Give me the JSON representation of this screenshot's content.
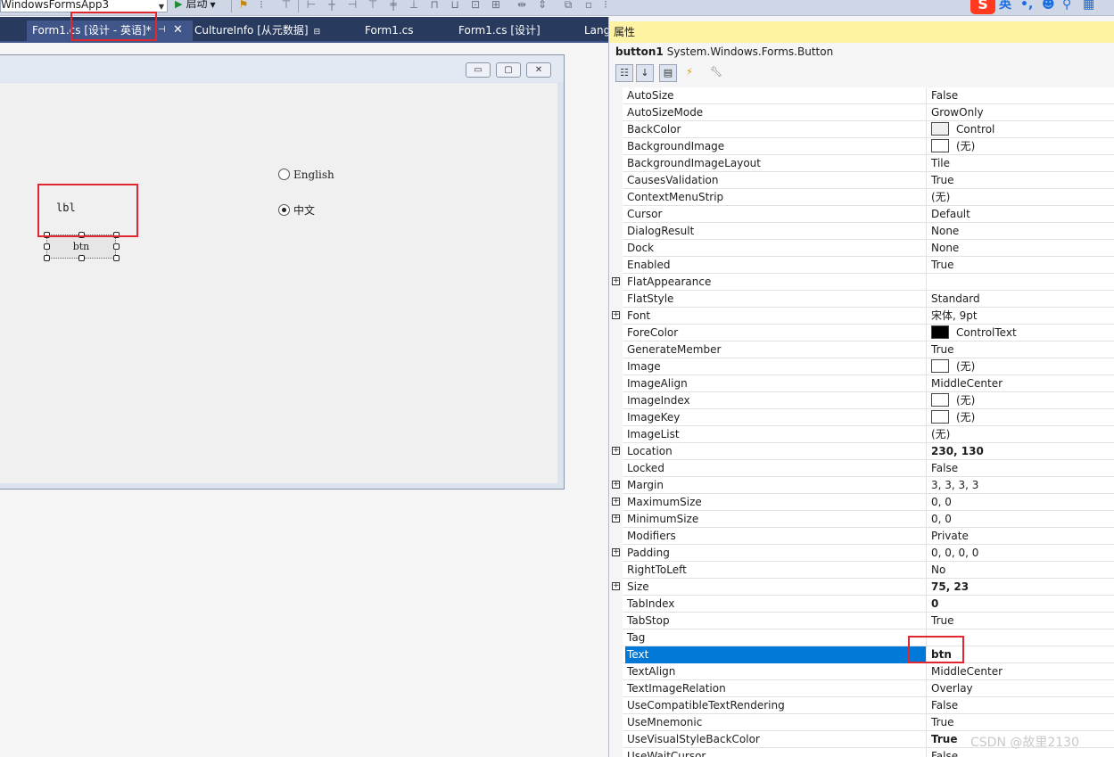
{
  "toolbar": {
    "project_name": "WindowsFormsApp3",
    "start_label": "启动"
  },
  "tabs": [
    {
      "label": "Form1.cs [设计 - 英语]*",
      "active": true
    },
    {
      "label": "CultureInfo [从元数据]"
    },
    {
      "label": "Form1.cs"
    },
    {
      "label": "Form1.cs [设计]"
    },
    {
      "label": "Lang"
    }
  ],
  "ime": {
    "language": "英",
    "punct": "•,"
  },
  "form": {
    "radio_english": "English",
    "radio_chinese": "中文",
    "radio_selected": "中文",
    "label_text": "lbl",
    "button_text": "btn"
  },
  "properties": {
    "title": "属性",
    "object_name": "button1",
    "object_type": "System.Windows.Forms.Button",
    "rows": [
      {
        "name": "AutoSize",
        "value": "False"
      },
      {
        "name": "AutoSizeMode",
        "value": "GrowOnly"
      },
      {
        "name": "BackColor",
        "value": "Control",
        "swatch": "control"
      },
      {
        "name": "BackgroundImage",
        "value": "(无)",
        "swatch": "white"
      },
      {
        "name": "BackgroundImageLayout",
        "value": "Tile"
      },
      {
        "name": "CausesValidation",
        "value": "True"
      },
      {
        "name": "ContextMenuStrip",
        "value": "(无)"
      },
      {
        "name": "Cursor",
        "value": "Default"
      },
      {
        "name": "DialogResult",
        "value": "None"
      },
      {
        "name": "Dock",
        "value": "None"
      },
      {
        "name": "Enabled",
        "value": "True"
      },
      {
        "name": "FlatAppearance",
        "value": "",
        "expandable": true
      },
      {
        "name": "FlatStyle",
        "value": "Standard"
      },
      {
        "name": "Font",
        "value": "宋体, 9pt",
        "expandable": true
      },
      {
        "name": "ForeColor",
        "value": "ControlText",
        "swatch": "black"
      },
      {
        "name": "GenerateMember",
        "value": "True"
      },
      {
        "name": "Image",
        "value": "(无)",
        "swatch": "white"
      },
      {
        "name": "ImageAlign",
        "value": "MiddleCenter"
      },
      {
        "name": "ImageIndex",
        "value": "(无)",
        "swatch": "white"
      },
      {
        "name": "ImageKey",
        "value": "(无)",
        "swatch": "white"
      },
      {
        "name": "ImageList",
        "value": "(无)"
      },
      {
        "name": "Location",
        "value": "230, 130",
        "expandable": true,
        "bold": true
      },
      {
        "name": "Locked",
        "value": "False"
      },
      {
        "name": "Margin",
        "value": "3, 3, 3, 3",
        "expandable": true
      },
      {
        "name": "MaximumSize",
        "value": "0, 0",
        "expandable": true
      },
      {
        "name": "MinimumSize",
        "value": "0, 0",
        "expandable": true
      },
      {
        "name": "Modifiers",
        "value": "Private"
      },
      {
        "name": "Padding",
        "value": "0, 0, 0, 0",
        "expandable": true
      },
      {
        "name": "RightToLeft",
        "value": "No"
      },
      {
        "name": "Size",
        "value": "75, 23",
        "expandable": true,
        "bold": true
      },
      {
        "name": "TabIndex",
        "value": "0",
        "bold": true
      },
      {
        "name": "TabStop",
        "value": "True"
      },
      {
        "name": "Tag",
        "value": ""
      },
      {
        "name": "Text",
        "value": "btn",
        "bold": true,
        "selected": true
      },
      {
        "name": "TextAlign",
        "value": "MiddleCenter"
      },
      {
        "name": "TextImageRelation",
        "value": "Overlay"
      },
      {
        "name": "UseCompatibleTextRendering",
        "value": "False"
      },
      {
        "name": "UseMnemonic",
        "value": "True"
      },
      {
        "name": "UseVisualStyleBackColor",
        "value": "True",
        "bold": true
      },
      {
        "name": "UseWaitCursor",
        "value": "False"
      }
    ]
  },
  "watermark": "CSDN @故里2130",
  "colors": {
    "highlight_red": "#e0262e",
    "selection_blue": "#0078d7",
    "tab_bar": "#283a5e",
    "properties_header": "#fdf3a3"
  }
}
